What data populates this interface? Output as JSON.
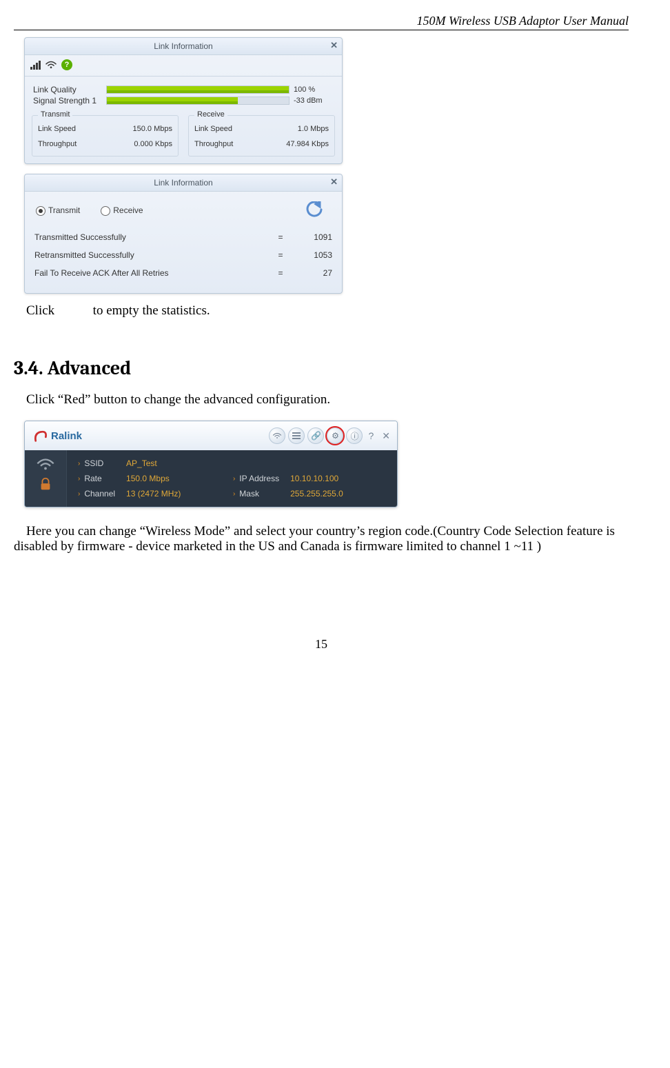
{
  "header": "150M Wireless USB Adaptor User Manual",
  "page_number": "15",
  "link1": {
    "title": "Link Information",
    "quality_label": "Link Quality",
    "quality_value": "100 %",
    "signal_label": "Signal Strength 1",
    "signal_value": "-33 dBm",
    "transmit_legend": "Transmit",
    "receive_legend": "Receive",
    "tx_speed_label": "Link Speed",
    "tx_speed_value": "150.0 Mbps",
    "tx_thr_label": "Throughput",
    "tx_thr_value": "0.000 Kbps",
    "rx_speed_label": "Link Speed",
    "rx_speed_value": "1.0 Mbps",
    "rx_thr_label": "Throughput",
    "rx_thr_value": "47.984 Kbps"
  },
  "link2": {
    "title": "Link Information",
    "radio_tx": "Transmit",
    "radio_rx": "Receive",
    "rows": [
      {
        "label": "Transmitted Successfully",
        "eq": "=",
        "value": "1091"
      },
      {
        "label": "Retransmitted Successfully",
        "eq": "=",
        "value": "1053"
      },
      {
        "label": "Fail To Receive ACK After All Retries",
        "eq": "=",
        "value": "27"
      }
    ]
  },
  "click_text_pre": "Click",
  "click_text_post": "to empty the statistics.",
  "section_heading": "3.4. Advanced",
  "section_intro": "Click “Red” button to change the advanced configuration.",
  "ralink": {
    "logo_text": "Ralink",
    "ssid_label": "SSID",
    "ssid_value": "AP_Test",
    "rate_label": "Rate",
    "rate_value": "150.0 Mbps",
    "ip_label": "IP Address",
    "ip_value": "10.10.10.100",
    "channel_label": "Channel",
    "channel_value": "13 (2472 MHz)",
    "mask_label": "Mask",
    "mask_value": "255.255.255.0"
  },
  "note_text": "Here you can change “Wireless Mode” and select your country’s region code.(Country Code Selection feature is disabled by firmware - device marketed in the US and Canada is firmware limited to channel 1 ~11 )"
}
